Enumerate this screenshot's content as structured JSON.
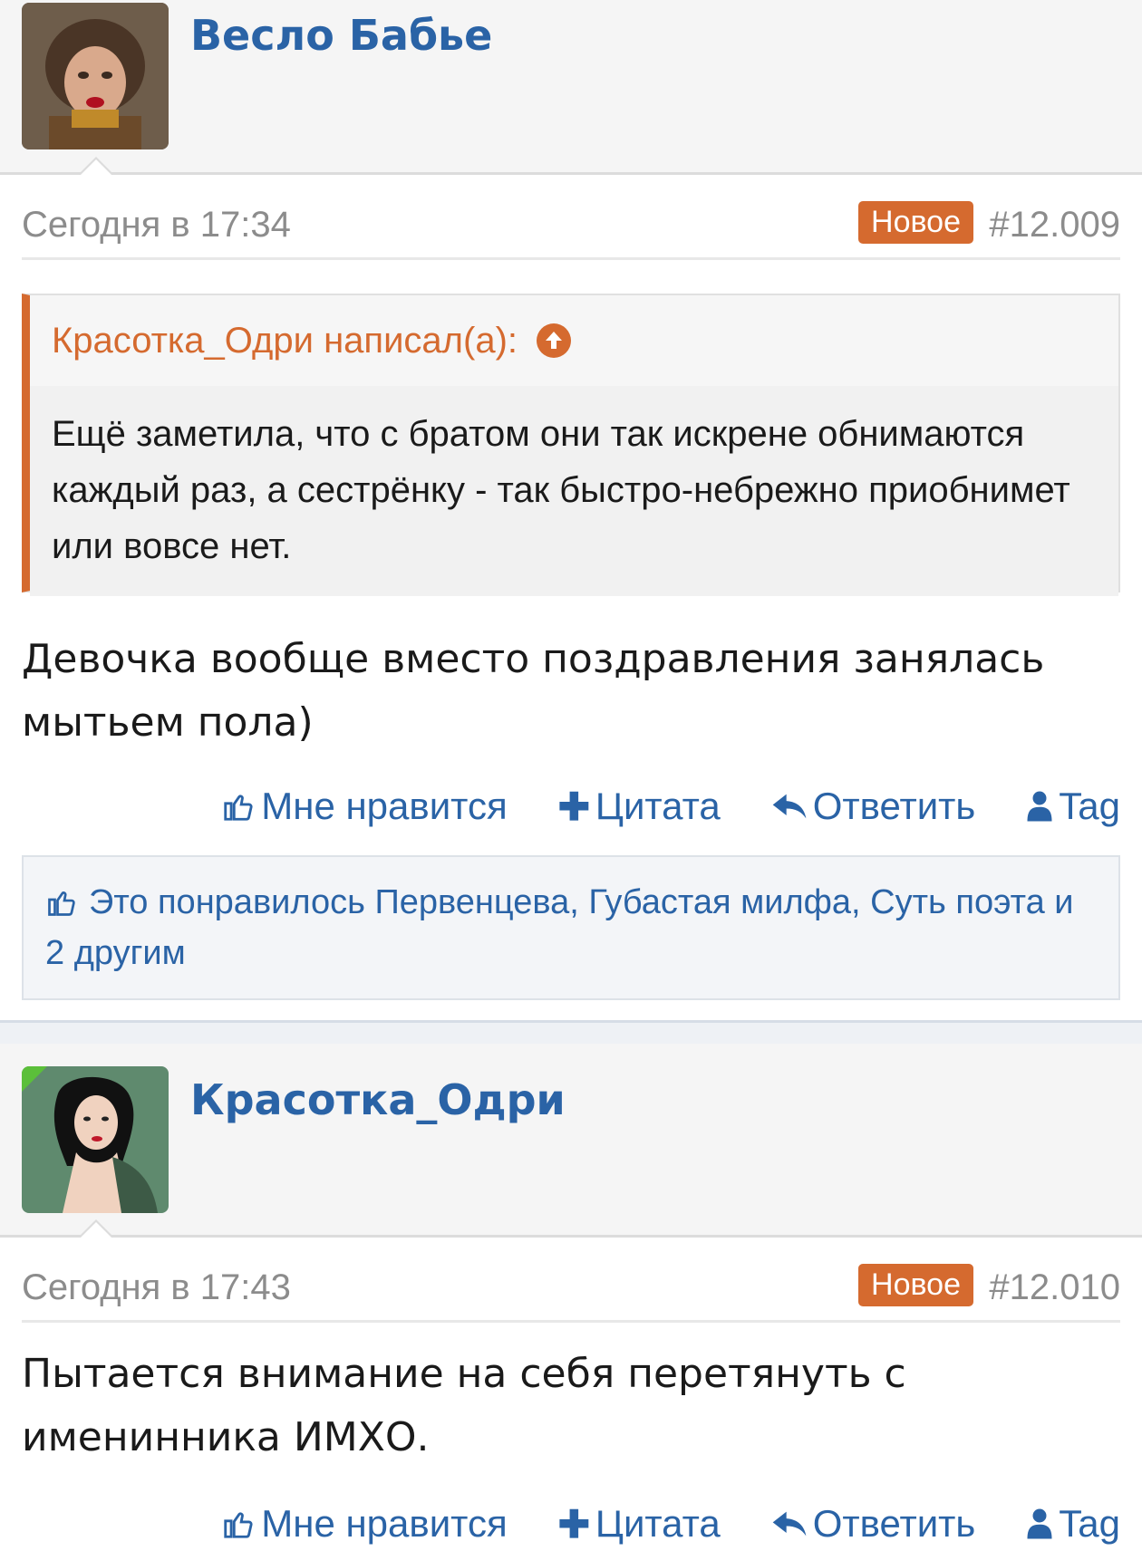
{
  "posts": [
    {
      "username": "Весло Бабье",
      "date": "Сегодня в 17:34",
      "badge": "Новое",
      "post_number": "#12.009",
      "quote": {
        "author_line": "Красотка_Одри написал(а):",
        "text": "Ещё заметила, что с братом они так искрене обнимаются каждый раз, а сестрёнку - так быстро-небрежно приобнимет или вовсе нет."
      },
      "message": "Девочка вообще вместо поздравления занялась мытьем пола)",
      "actions": {
        "like": "Мне нравится",
        "quote": "Цитата",
        "reply": "Ответить",
        "tag": "Tag"
      },
      "likes_text": "Это понравилось Первенцева, Губастая милфа, Суть поэта и 2 другим"
    },
    {
      "username": "Красотка_Одри",
      "date": "Сегодня в 17:43",
      "badge": "Новое",
      "post_number": "#12.010",
      "message": "Пытается внимание на себя перетянуть с именинника ИМХО.",
      "actions": {
        "like": "Мне нравится",
        "quote": "Цитата",
        "reply": "Ответить",
        "tag": "Tag"
      }
    }
  ],
  "colors": {
    "link": "#2a63a6",
    "accent": "#d56a2f",
    "muted": "#8c8c8c"
  }
}
